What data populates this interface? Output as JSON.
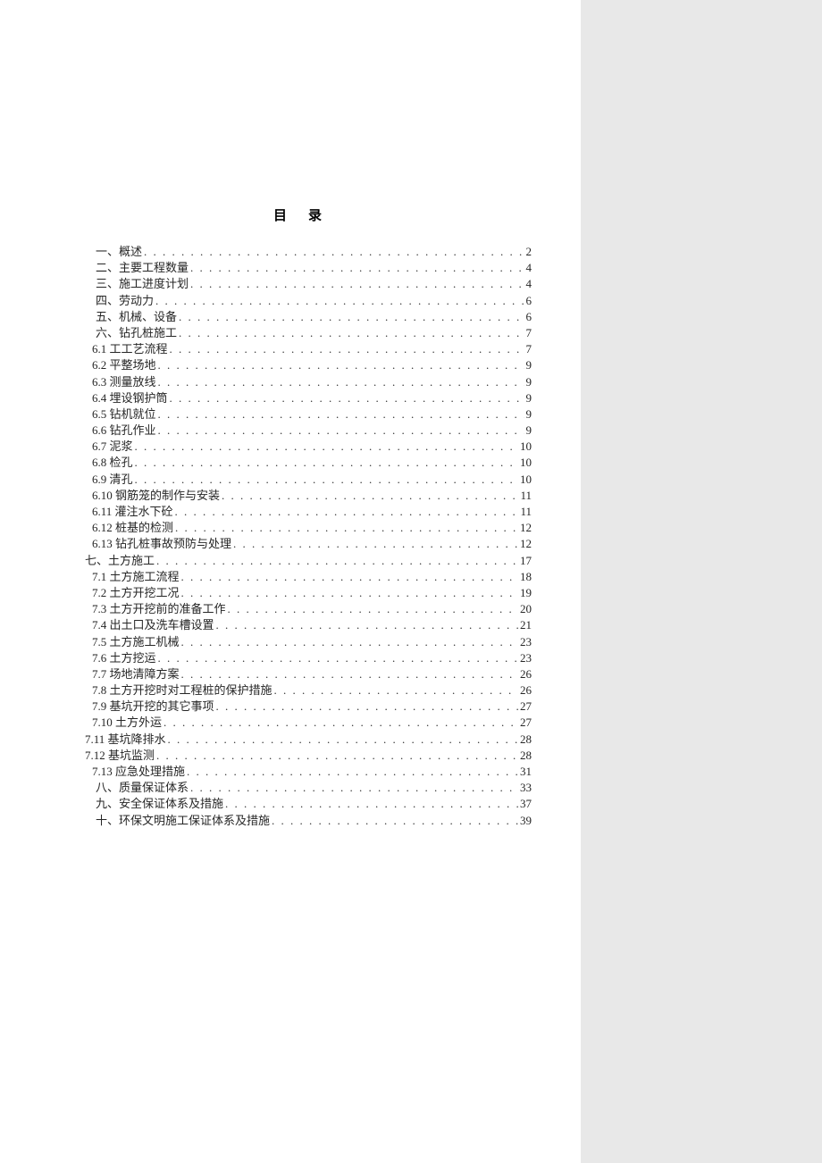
{
  "title": "目录",
  "entries": [
    {
      "label": "一、概述",
      "page": "2",
      "indent": "indent-1"
    },
    {
      "label": "二、主要工程数量",
      "page": "4",
      "indent": "indent-1"
    },
    {
      "label": "三、施工进度计划",
      "page": "4",
      "indent": "indent-1"
    },
    {
      "label": "四、劳动力",
      "page": "6",
      "indent": "indent-1"
    },
    {
      "label": "五、机械、设备",
      "page": "6",
      "indent": "indent-1"
    },
    {
      "label": "六、钻孔桩施工",
      "page": "7",
      "indent": "indent-1"
    },
    {
      "label": "6.1 工工艺流程",
      "page": "7",
      "indent": "indent-sub"
    },
    {
      "label": "6.2 平整场地",
      "page": "9",
      "indent": "indent-sub"
    },
    {
      "label": "6.3 测量放线",
      "page": "9",
      "indent": "indent-sub"
    },
    {
      "label": "6.4 埋设钢护筒",
      "page": "9",
      "indent": "indent-sub"
    },
    {
      "label": "6.5 钻机就位",
      "page": "9",
      "indent": "indent-sub"
    },
    {
      "label": "6.6 钻孔作业",
      "page": "9",
      "indent": "indent-sub"
    },
    {
      "label": "6.7 泥浆",
      "page": "10",
      "indent": "indent-sub"
    },
    {
      "label": "6.8 检孔",
      "page": "10",
      "indent": "indent-sub"
    },
    {
      "label": "6.9 清孔",
      "page": "10",
      "indent": "indent-sub"
    },
    {
      "label": "6.10 钢筋笼的制作与安装",
      "page": "11",
      "indent": "indent-sub"
    },
    {
      "label": "6.11 灌注水下砼",
      "page": "11",
      "indent": "indent-sub"
    },
    {
      "label": "6.12 桩基的检测",
      "page": "12",
      "indent": "indent-sub"
    },
    {
      "label": "6.13 钻孔桩事故预防与处理",
      "page": "12",
      "indent": "indent-sub"
    },
    {
      "label": "七、土方施工",
      "page": "17",
      "indent": "indent-0"
    },
    {
      "label": "7.1 土方施工流程",
      "page": "18",
      "indent": "indent-sub"
    },
    {
      "label": "7.2 土方开挖工况",
      "page": "19",
      "indent": "indent-sub"
    },
    {
      "label": "7.3 土方开挖前的准备工作",
      "page": "20",
      "indent": "indent-sub"
    },
    {
      "label": "7.4 出土口及洗车槽设置",
      "page": "21",
      "indent": "indent-sub"
    },
    {
      "label": "7.5 土方施工机械",
      "page": "23",
      "indent": "indent-sub"
    },
    {
      "label": "7.6 土方挖运",
      "page": "23",
      "indent": "indent-sub"
    },
    {
      "label": "7.7 场地清障方案",
      "page": "26",
      "indent": "indent-sub"
    },
    {
      "label": "7.8 土方开挖时对工程桩的保护措施",
      "page": "26",
      "indent": "indent-sub"
    },
    {
      "label": "7.9 基坑开挖的其它事项",
      "page": "27",
      "indent": "indent-sub"
    },
    {
      "label": "7.10 土方外运",
      "page": "27",
      "indent": "indent-sub"
    },
    {
      "label": "7.11 基坑降排水",
      "page": "28",
      "indent": "indent-0"
    },
    {
      "label": "7.12 基坑监测",
      "page": "28",
      "indent": "indent-0"
    },
    {
      "label": "7.13 应急处理措施",
      "page": "31",
      "indent": "indent-sub"
    },
    {
      "label": "八、质量保证体系",
      "page": "33",
      "indent": "indent-1"
    },
    {
      "label": "九、安全保证体系及措施",
      "page": "37",
      "indent": "indent-1"
    },
    {
      "label": "十、环保文明施工保证体系及措施",
      "page": "39",
      "indent": "indent-1"
    }
  ]
}
